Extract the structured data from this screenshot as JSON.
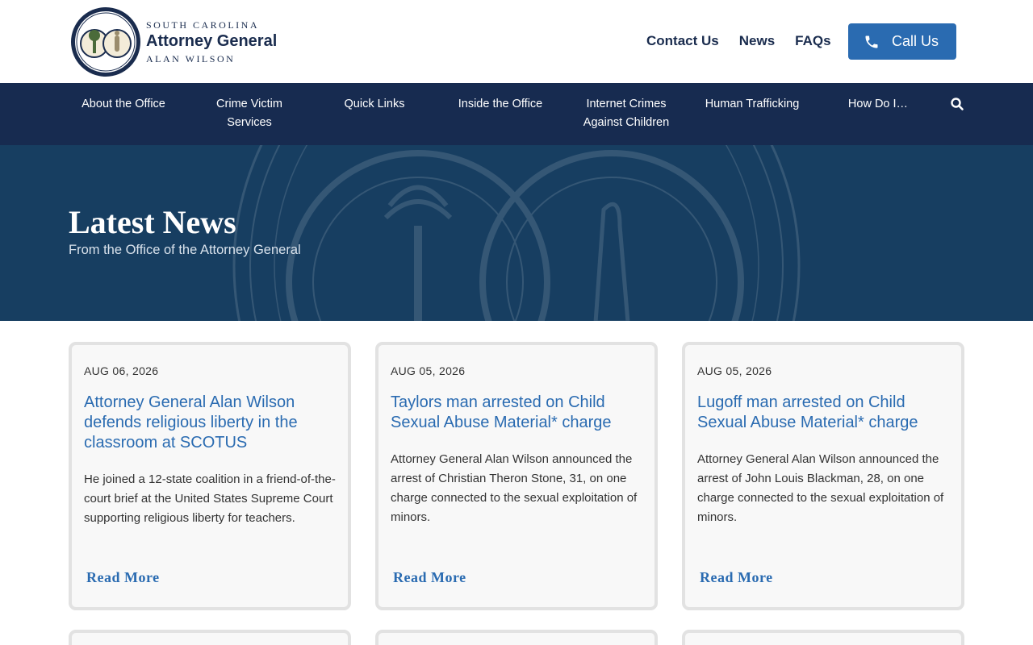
{
  "header": {
    "logo": {
      "line1": "SOUTH CAROLINA",
      "line2": "Attorney General",
      "line3": "ALAN WILSON",
      "seal_icon": "state-seal-icon"
    },
    "links": [
      "Contact Us",
      "News",
      "FAQs"
    ],
    "call_button": {
      "label": "Call Us",
      "icon": "phone-icon"
    }
  },
  "nav": {
    "items": [
      "About the Office",
      "Crime Victim Services",
      "Quick Links",
      "Inside the Office",
      "Internet Crimes Against Children",
      "Human Trafficking",
      "How Do I…"
    ],
    "search_icon": "search-icon"
  },
  "hero": {
    "title": "Latest News",
    "subtitle": "From the Office of the Attorney General"
  },
  "cards": [
    {
      "date": "AUG 06, 2026",
      "title": "Attorney General Alan Wilson defends religious liberty in the classroom at SCOTUS",
      "excerpt": "He joined a 12-state coalition in a friend-of-the-court brief at the United States Supreme Court supporting religious liberty for teachers.",
      "more": "Read More"
    },
    {
      "date": "AUG 05, 2026",
      "title": "Taylors man arrested on Child Sexual Abuse Material* charge",
      "excerpt": "Attorney General Alan Wilson announced the arrest of Christian Theron Stone, 31, on one charge connected to the sexual exploitation of minors.",
      "more": "Read More"
    },
    {
      "date": "AUG 05, 2026",
      "title": "Lugoff man arrested on Child Sexual Abuse Material* charge",
      "excerpt": "Attorney General Alan Wilson announced the arrest of John Louis Blackman, 28, on one charge connected to the sexual exploitation of minors.",
      "more": "Read More"
    }
  ],
  "colors": {
    "navy": "#172b50",
    "hero": "#173e61",
    "accent_blue": "#2a6bb1",
    "card_bg": "#f8f8f8",
    "card_border": "#e2e2e2"
  }
}
